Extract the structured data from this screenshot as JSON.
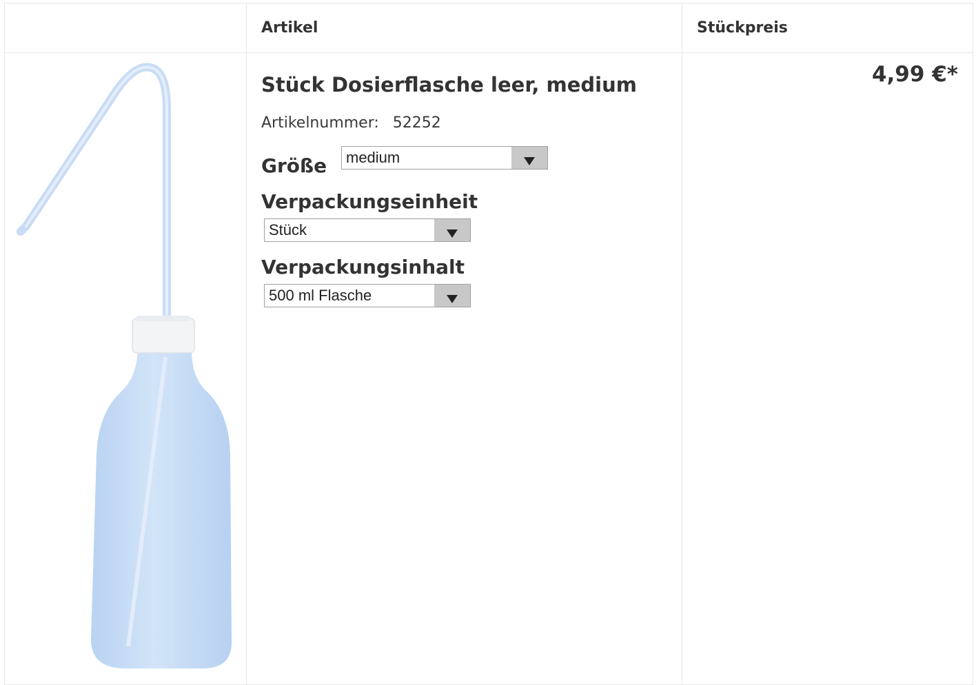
{
  "table": {
    "headers": {
      "article": "Artikel",
      "unit_price": "Stückpreis"
    }
  },
  "product": {
    "title": "Stück Dosierflasche leer, medium",
    "article_number_label": "Artikelnummer:",
    "article_number": "52252",
    "price": "4,99 €*",
    "image_icon": "wash-bottle-image",
    "options": [
      {
        "label": "Größe",
        "selected": "medium"
      },
      {
        "label": "Verpackungseinheit",
        "selected": "Stück"
      },
      {
        "label": "Verpackungsinhalt",
        "selected": "500 ml Flasche"
      }
    ]
  },
  "colors": {
    "bottle": "#c6dcf5",
    "cap": "#f2f4f6",
    "border": "#e6e6e6",
    "select_arrow_bg": "#c8c8c8"
  }
}
